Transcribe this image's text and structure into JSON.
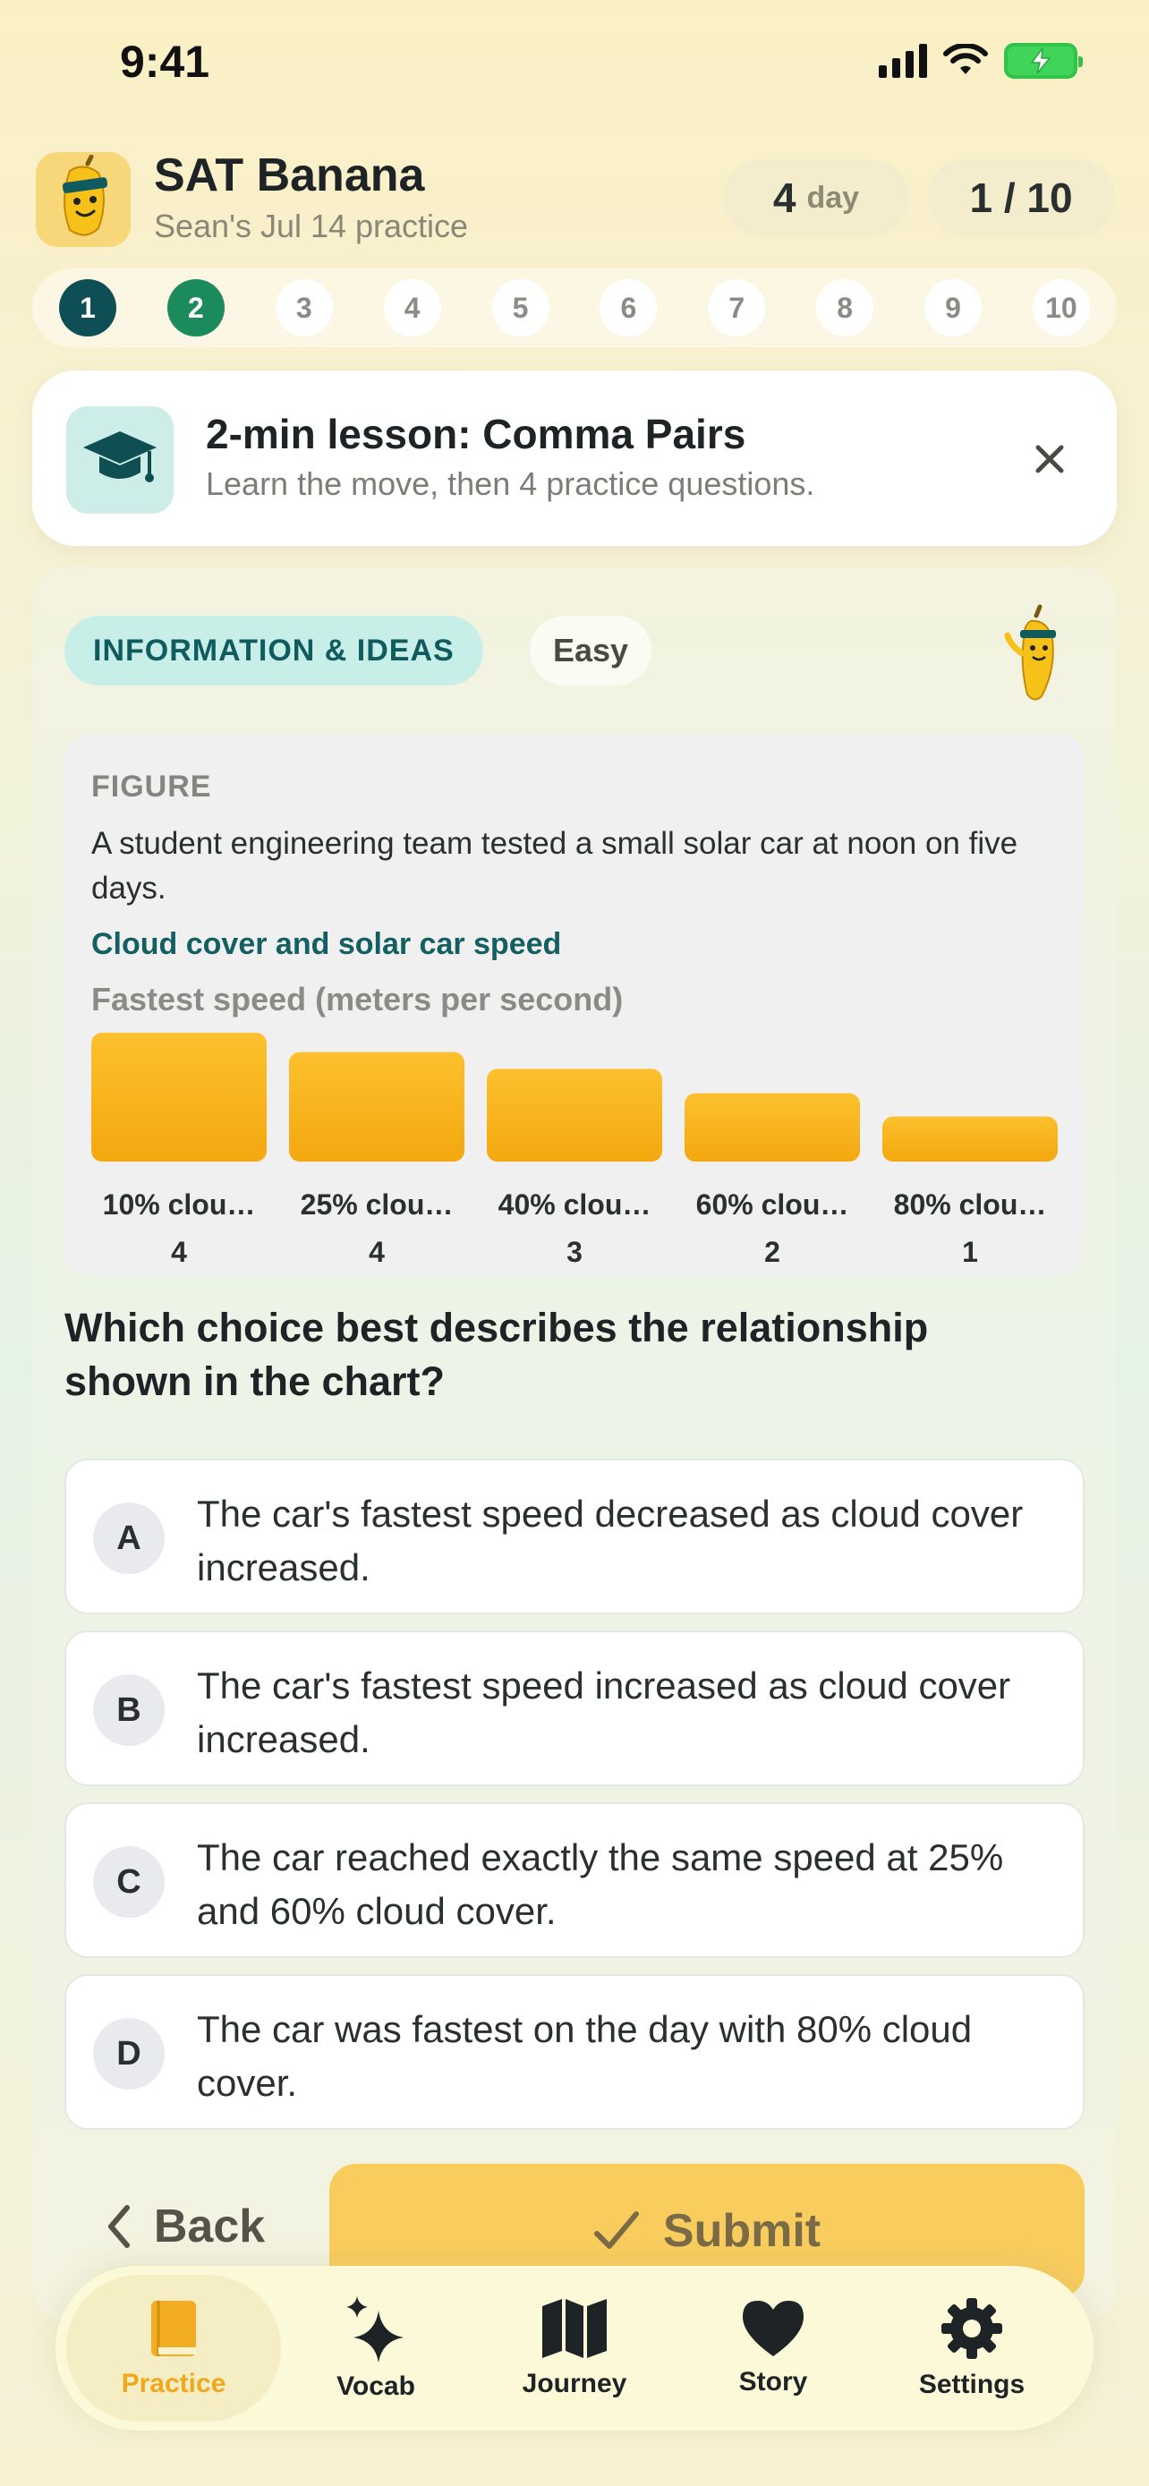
{
  "status_bar": {
    "time": "9:41"
  },
  "header": {
    "app_title": "SAT Banana",
    "subtitle": "Sean's Jul 14 practice",
    "streak_count": "4",
    "streak_unit": "day",
    "progress": "1 / 10"
  },
  "stepper": {
    "steps": [
      "1",
      "2",
      "3",
      "4",
      "5",
      "6",
      "7",
      "8",
      "9",
      "10"
    ],
    "current_step": 1,
    "active_step": 2
  },
  "lesson": {
    "title": "2-min lesson: Comma Pairs",
    "subtitle": "Learn the move, then 4 practice questions."
  },
  "question_card": {
    "domain_tag": "INFORMATION & IDEAS",
    "difficulty": "Easy",
    "figure_label": "FIGURE",
    "figure_description": "A student engineering team tested a small solar car at noon on five days.",
    "question": "Which choice best describes the relationship shown in the chart?",
    "choices": [
      {
        "letter": "A",
        "text": "The car's fastest speed decreased as cloud cover increased."
      },
      {
        "letter": "B",
        "text": "The car's fastest speed increased as cloud cover increased."
      },
      {
        "letter": "C",
        "text": "The car reached exactly the same speed at 25% and 60% cloud cover."
      },
      {
        "letter": "D",
        "text": "The car was fastest on the day with 80% cloud cover."
      }
    ]
  },
  "chart_data": {
    "type": "bar",
    "title": "Cloud cover and solar car speed",
    "ylabel": "Fastest speed (meters per second)",
    "categories": [
      "10% clou…",
      "25% clou…",
      "40% clou…",
      "60% clou…",
      "80% clou…"
    ],
    "values": [
      4,
      4,
      3,
      2,
      1
    ],
    "display_values": [
      "4",
      "4",
      "3",
      "2",
      "1"
    ],
    "bar_heights_relative": [
      1.0,
      0.85,
      0.72,
      0.53,
      0.35
    ],
    "colors": {
      "bar_top": "#fcc12f",
      "bar_bottom": "#f3a80f",
      "label": "#2a2f30"
    }
  },
  "actions": {
    "back_label": "Back",
    "submit_label": "Submit"
  },
  "tabs": [
    {
      "label": "Practice",
      "icon": "book-icon"
    },
    {
      "label": "Vocab",
      "icon": "sparkles-icon"
    },
    {
      "label": "Journey",
      "icon": "map-icon"
    },
    {
      "label": "Story",
      "icon": "heart-icon"
    },
    {
      "label": "Settings",
      "icon": "gear-icon"
    }
  ],
  "colors": {
    "accent_teal": "#0d4f55",
    "accent_green": "#1b8b5c",
    "accent_yellow": "#f8cd5e",
    "tab_active": "#f0a91c"
  }
}
